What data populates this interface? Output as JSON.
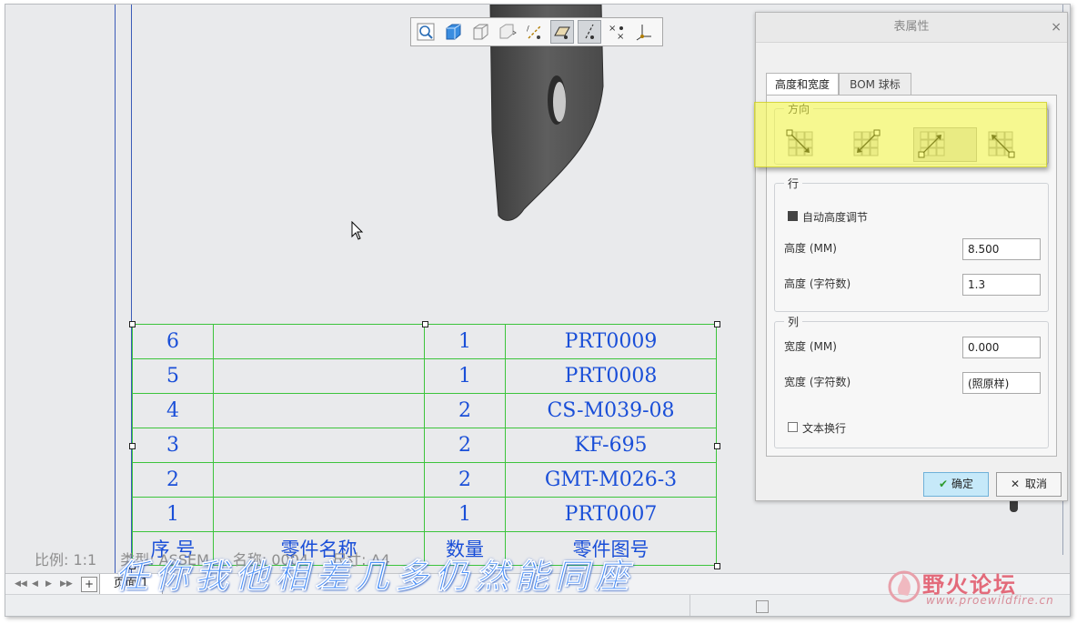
{
  "toolbar": {
    "icons": [
      "zoom-icon",
      "shaded-cube-icon",
      "no-hidden-cube-icon",
      "repaint-icon",
      "datum-axis-icon",
      "datum-plane-icon",
      "datum-point-icon",
      "point-display-icon",
      "coordinate-system-icon"
    ]
  },
  "bom_table": {
    "rows": [
      {
        "index": "6",
        "name": "",
        "qty": "1",
        "part": "PRT0009"
      },
      {
        "index": "5",
        "name": "",
        "qty": "1",
        "part": "PRT0008"
      },
      {
        "index": "4",
        "name": "",
        "qty": "2",
        "part": "CS-M039-08"
      },
      {
        "index": "3",
        "name": "",
        "qty": "2",
        "part": "KF-695"
      },
      {
        "index": "2",
        "name": "",
        "qty": "2",
        "part": "GMT-M026-3"
      },
      {
        "index": "1",
        "name": "",
        "qty": "1",
        "part": "PRT0007"
      }
    ],
    "header": {
      "index": "序  号",
      "name": "零件名称",
      "qty": "数量",
      "part": "零件图号"
    }
  },
  "status": {
    "scale": "比例: 1:1",
    "type": "类型: ASSEM",
    "name": "名称: 0004",
    "size": "尺寸: A4"
  },
  "sheetbar": {
    "sheet_tab": "页面 1",
    "add_label": "+"
  },
  "overlay_caption": "任你我他相差几多仍然能同座",
  "logo": {
    "title": "野火论坛",
    "url": "www.proewildfire.cn"
  },
  "dialog": {
    "title": "表属性",
    "close": "×",
    "tabs": [
      "高度和宽度",
      "BOM 球标"
    ],
    "direction_group": "方向",
    "row_group": "行",
    "auto_height": "自动高度调节",
    "height_mm_label": "高度 (MM)",
    "height_mm_value": "8.500",
    "height_chars_label": "高度 (字符数)",
    "height_chars_value": "1.3",
    "col_group": "列",
    "width_mm_label": "宽度 (MM)",
    "width_mm_value": "0.000",
    "width_chars_label": "宽度 (字符数)",
    "width_chars_value": "(照原样)",
    "wrap_text": "文本换行",
    "ok": "确定",
    "cancel": "取消"
  },
  "colors": {
    "table_grid": "#3cc43c",
    "table_text": "#1a4fd8",
    "highlight": "#f5fa3c",
    "ok_button": "#c6e9f9"
  }
}
